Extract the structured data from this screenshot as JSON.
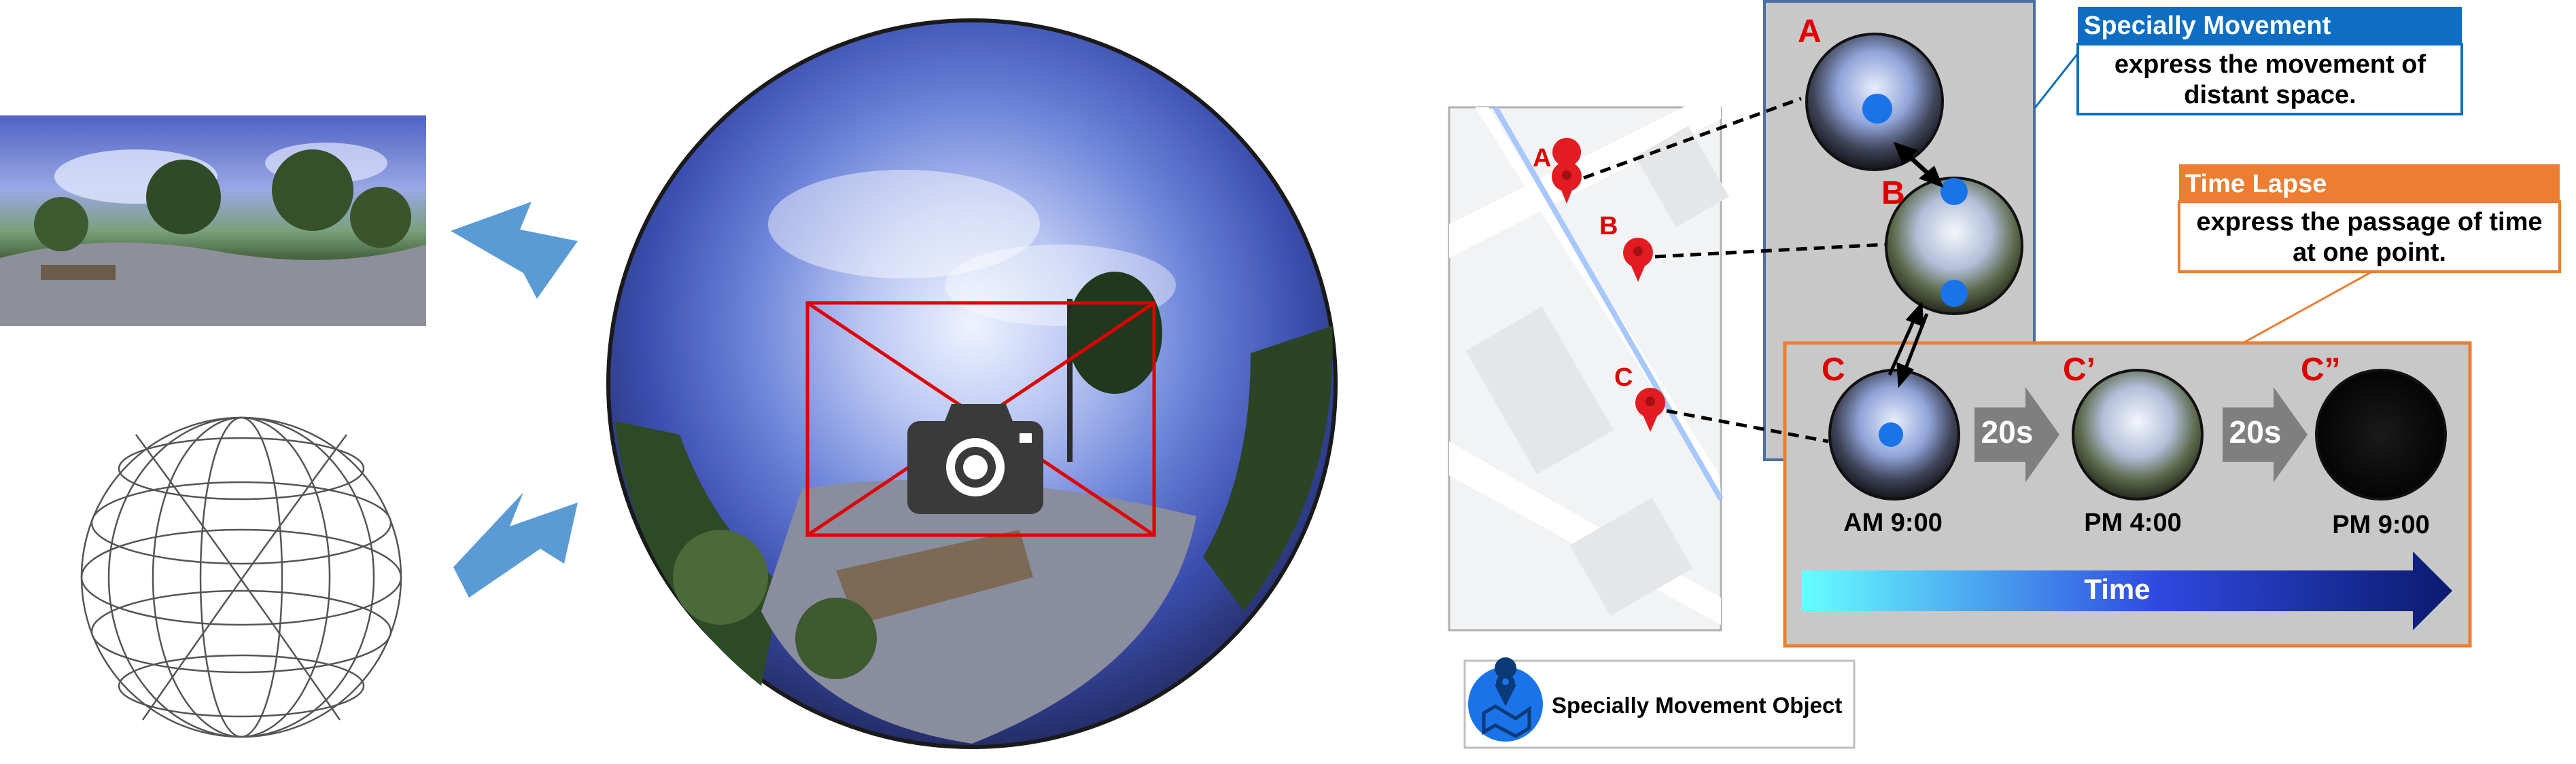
{
  "colors": {
    "pin_red": "#e31b23",
    "label_red": "#e00000",
    "arrow_blue": "#5b9bd5",
    "specially_blue": "#0d6ec4",
    "time_lapse_orange": "#ed7d31",
    "panel_gray": "#c8c8c8",
    "time_bar_start": "#66ffff",
    "time_bar_end": "#0b1a6e"
  },
  "icons": {
    "camera": "camera-icon",
    "map_pin": "map-pin-icon",
    "movement_object": "map-location-icon"
  },
  "map_pins": [
    "A",
    "B",
    "C"
  ],
  "specially_movement": {
    "title": "Specially Movement",
    "desc_line1": "express the movement of",
    "desc_line2": "distant space.",
    "views": [
      "A",
      "B"
    ]
  },
  "time_lapse": {
    "title": "Time Lapse",
    "desc_line1": "express the passage of time",
    "desc_line2": "at one point.",
    "views": [
      {
        "label": "C",
        "time": "AM 9:00"
      },
      {
        "label": "C’",
        "time": "PM 4:00"
      },
      {
        "label": "C”",
        "time": "PM 9:00"
      }
    ],
    "intervals": [
      "20s",
      "20s"
    ],
    "axis_label": "Time"
  },
  "legend": {
    "label": "Specially Movement Object"
  }
}
